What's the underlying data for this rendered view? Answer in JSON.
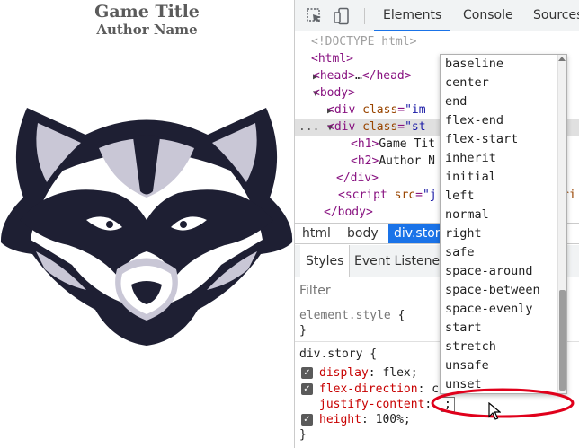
{
  "page": {
    "title": "Game Title",
    "author": "Author Name"
  },
  "devtools": {
    "tabs": [
      "Elements",
      "Console",
      "Sources"
    ],
    "active_tab": "Elements",
    "icons": [
      "inspect-element-icon",
      "device-toolbar-icon"
    ],
    "dom_tree": {
      "doctype": "<!DOCTYPE html>",
      "html_open": "<html>",
      "head_open": "<head>",
      "head_ellipsis": "…",
      "head_close": "</head>",
      "body_open": "<body>",
      "div1_open": "<div",
      "div1_attr": "class",
      "div1_val_partial": "\"im",
      "div2_open": "<div",
      "div2_attr": "class",
      "div2_val_partial": "\"st",
      "h1_open": "<h1>",
      "h1_text": "Game Tit",
      "h2_open": "<h2>",
      "h2_text": "Author N",
      "div_close": "</div>",
      "script_open": "<script",
      "script_attr": "src",
      "script_val_partial": "\"j",
      "script_tail": "ri",
      "body_close": "</body>",
      "dots": "..."
    },
    "breadcrumbs": [
      "html",
      "body",
      "div.story"
    ],
    "styles_tabs": [
      "Styles",
      "Event Listener"
    ],
    "filter_placeholder": "Filter",
    "css": {
      "element_style_selector": "element.style",
      "open_brace": "{",
      "close_brace": "}",
      "rule_selector": "div.story",
      "declarations": [
        {
          "prop": "display",
          "value": "flex;"
        },
        {
          "prop": "flex-direction",
          "value": "c"
        },
        {
          "prop": "justify-content",
          "value": ""
        },
        {
          "prop": "height",
          "value": "100%;"
        }
      ],
      "colon": ":",
      "edit_value": ";"
    },
    "autocomplete": [
      "baseline",
      "center",
      "end",
      "flex-end",
      "flex-start",
      "inherit",
      "initial",
      "left",
      "normal",
      "right",
      "safe",
      "space-around",
      "space-between",
      "space-evenly",
      "start",
      "stretch",
      "unsafe",
      "unset"
    ]
  },
  "colors": {
    "accent_blue": "#1a73e8",
    "annotation_red": "#e0001b",
    "tag_purple": "#881280",
    "attr_brown": "#994500",
    "prop_red": "#c80000"
  }
}
